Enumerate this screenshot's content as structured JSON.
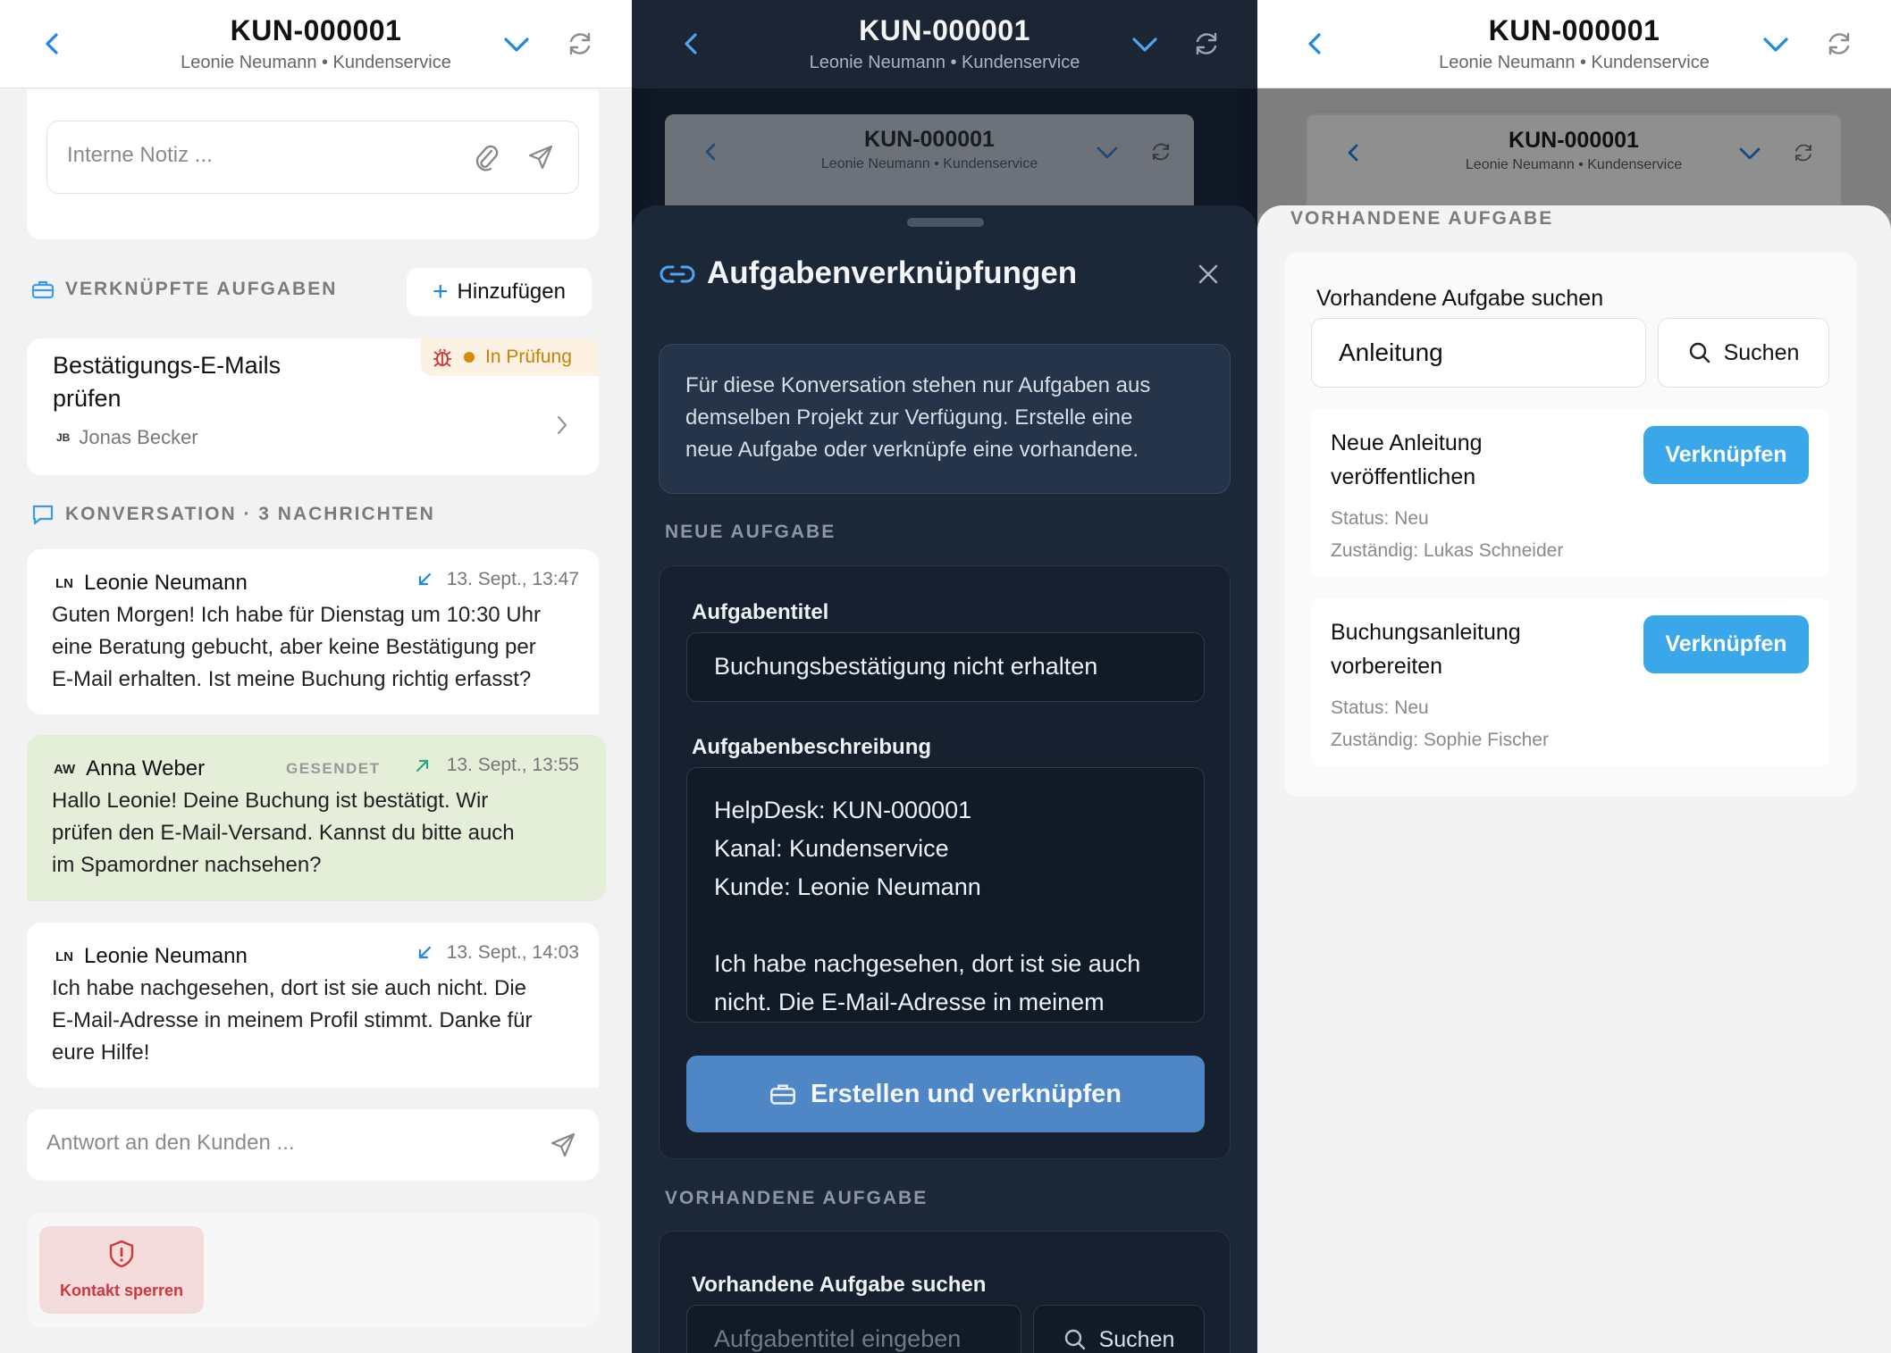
{
  "header": {
    "ticket_id": "KUN-000001",
    "subtitle": "Leonie Neumann • Kundenservice"
  },
  "panel1": {
    "note_placeholder": "Interne Notiz ...",
    "linked_tasks_label": "VERKNÜPFTE AUFGABEN",
    "add_button": "Hinzufügen",
    "task": {
      "title_line1": "Bestätigungs-E-Mails",
      "title_line2": "prüfen",
      "assignee_initials": "JB",
      "assignee": "Jonas Becker",
      "status": "In Prüfung"
    },
    "conversation_label": "KONVERSATION · 3 NACHRICHTEN",
    "messages": [
      {
        "initials": "LN",
        "name": "Leonie Neumann",
        "time": "13. Sept., 13:47",
        "lines": [
          "Guten Morgen! Ich habe für Dienstag um 10:30 Uhr",
          "eine Beratung gebucht, aber keine Bestätigung per",
          "E-Mail erhalten. Ist meine Buchung richtig erfasst?"
        ]
      },
      {
        "initials": "AW",
        "name": "Anna Weber",
        "sent_label": "GESENDET",
        "time": "13. Sept., 13:55",
        "lines": [
          "Hallo Leonie! Deine Buchung ist bestätigt. Wir",
          "prüfen den E-Mail-Versand. Kannst du bitte auch",
          "im Spamordner nachsehen?"
        ]
      },
      {
        "initials": "LN",
        "name": "Leonie Neumann",
        "time": "13. Sept., 14:03",
        "lines": [
          "Ich habe nachgesehen, dort ist sie auch nicht. Die",
          "E-Mail-Adresse in meinem Profil stimmt. Danke für",
          "eure Hilfe!"
        ]
      }
    ],
    "reply_placeholder": "Antwort an den Kunden ...",
    "block_button": "Kontakt sperren"
  },
  "panel2": {
    "sheet_title": "Aufgabenverknüpfungen",
    "info_lines": [
      "Für diese Konversation stehen nur Aufgaben aus",
      "demselben Projekt zur Verfügung. Erstelle eine",
      "neue Aufgabe oder verknüpfe eine vorhandene."
    ],
    "new_task_label": "NEUE AUFGABE",
    "title_label": "Aufgabentitel",
    "title_value": "Buchungsbestätigung nicht erhalten",
    "desc_label": "Aufgabenbeschreibung",
    "desc_lines": [
      "HelpDesk: KUN-000001",
      "Kanal: Kundenservice",
      "Kunde: Leonie Neumann",
      "",
      "Ich habe nachgesehen, dort ist sie auch",
      "nicht. Die E-Mail-Adresse in meinem"
    ],
    "create_button": "Erstellen und verknüpfen",
    "existing_label": "VORHANDENE AUFGABE",
    "search_label": "Vorhandene Aufgabe suchen",
    "search_placeholder": "Aufgabentitel eingeben",
    "search_button": "Suchen"
  },
  "panel3": {
    "existing_label": "VORHANDENE AUFGABE",
    "search_label": "Vorhandene Aufgabe suchen",
    "search_value": "Anleitung",
    "search_button": "Suchen",
    "results": [
      {
        "title_line1": "Neue Anleitung",
        "title_line2": "veröffentlichen",
        "status": "Status: Neu",
        "assignee": "Zuständig: Lukas Schneider",
        "link_button": "Verknüpfen"
      },
      {
        "title_line1": "Buchungsanleitung",
        "title_line2": "vorbereiten",
        "status": "Status: Neu",
        "assignee": "Zuständig: Sophie Fischer",
        "link_button": "Verknüpfen"
      }
    ]
  },
  "colors": {
    "accent_blue": "#1e88e5",
    "link_button": "#3aa7ea",
    "create_button": "#4f86c6",
    "status_orange": "#d98b00",
    "sent_bubble": "#e4eed8",
    "danger_red": "#d0363b"
  }
}
